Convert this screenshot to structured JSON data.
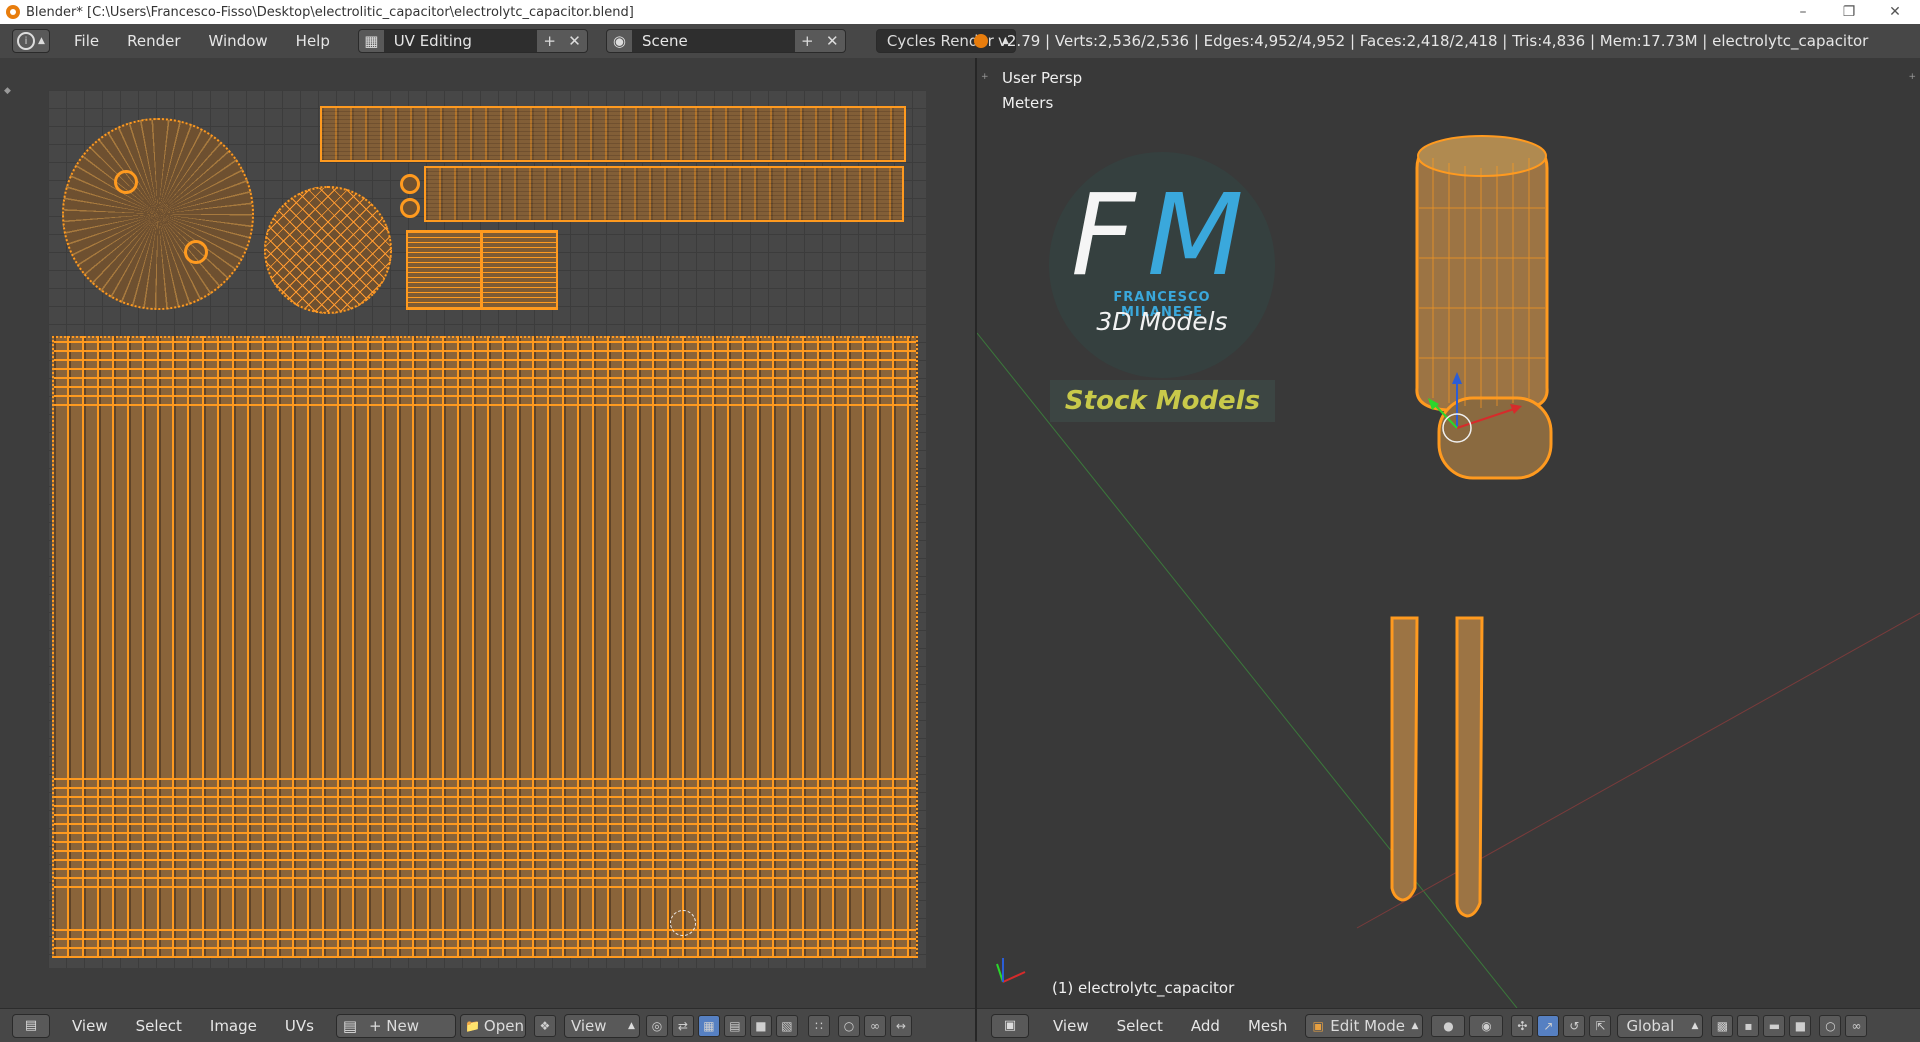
{
  "title_bar": {
    "text": "Blender* [C:\\Users\\Francesco-Fisso\\Desktop\\electrolitic_capacitor\\electrolytc_capacitor.blend]"
  },
  "top_menu": [
    "File",
    "Render",
    "Window",
    "Help"
  ],
  "screen_layout": "UV Editing",
  "scene": "Scene",
  "render_engine": "Cycles Render",
  "stats": "v2.79 | Verts:2,536/2,536 | Edges:4,952/4,952 | Faces:2,418/2,418 | Tris:4,836 | Mem:17.73M | electrolytc_capacitor",
  "viewport": {
    "view_name": "User Persp",
    "units": "Meters",
    "object_label": "(1) electrolytc_capacitor",
    "logo": {
      "initials_f": "F",
      "initials_m": "M",
      "brand": "FRANCESCO MILANESE",
      "subtitle": "3D Models",
      "banner": "Stock Models"
    }
  },
  "uv_editor_bar": {
    "menus": [
      "View",
      "Select",
      "Image",
      "UVs"
    ],
    "new_label": "New",
    "open_label": "Open",
    "view_label": "View"
  },
  "view3d_bar": {
    "menus": [
      "View",
      "Select",
      "Add",
      "Mesh"
    ],
    "mode": "Edit Mode",
    "orientation": "Global"
  },
  "colors": {
    "accent_orange": "#ff9a1f",
    "logo_blue": "#3aa8dc",
    "banner_yellow": "#c8c94a"
  },
  "icons": [
    "info-icon",
    "layout-icon",
    "scene-icon",
    "blender-icon",
    "image-editor-icon",
    "3d-view-icon",
    "pin-icon",
    "camera-icon",
    "sphere-shading-icon",
    "pivot-icon",
    "translate-manipulator-icon",
    "rotate-manipulator-icon",
    "scale-manipulator-icon",
    "vertex-select-icon",
    "edge-select-icon",
    "face-select-icon"
  ]
}
